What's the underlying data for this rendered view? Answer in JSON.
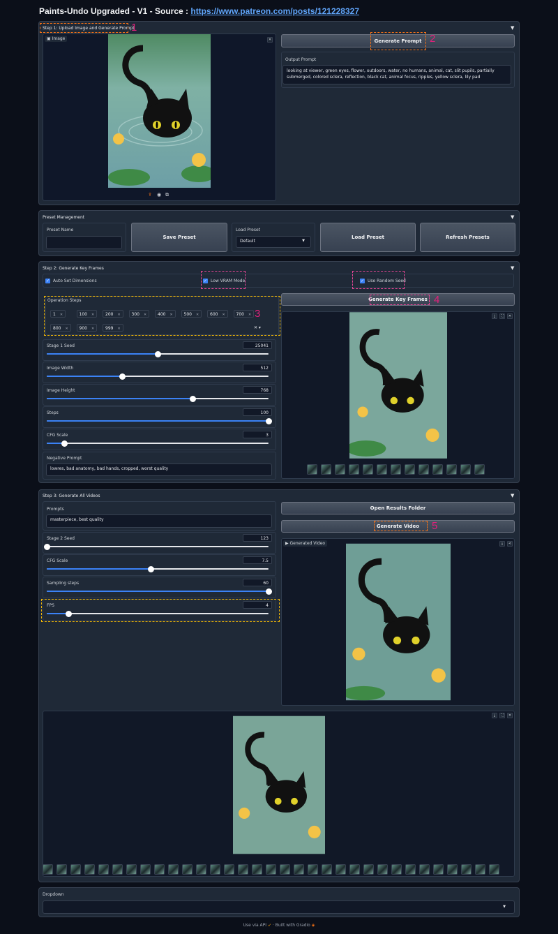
{
  "title": "Paints-Undo Upgraded - V1 - Source : ",
  "title_link": "https://www.patreon.com/posts/121228327",
  "step1": {
    "title": "Step 1: Upload Image and Generate Prompt",
    "image_label": "Image",
    "generate_btn": "Generate Prompt",
    "output_label": "Output Prompt",
    "output_value": "looking at viewer, green eyes, flower, outdoors, water, no humans, animal, cat, slit pupils, partially submerged, colored sclera, reflection, black cat, animal focus, ripples, yellow sclera, lily pad"
  },
  "preset": {
    "title": "Preset Management",
    "name_label": "Preset Name",
    "save_btn": "Save Preset",
    "load_label": "Load Preset",
    "load_value": "Default",
    "load_btn": "Load Preset",
    "refresh_btn": "Refresh Presets"
  },
  "step2": {
    "title": "Step 2: Generate Key Frames",
    "auto_dims": "Auto Set Dimensions",
    "low_vram": "Low VRAM Mode",
    "random_seed": "Use Random Seed",
    "op_steps_label": "Operation Steps",
    "op_steps": [
      "1",
      "100",
      "200",
      "300",
      "400",
      "500",
      "600",
      "700",
      "800",
      "900",
      "999"
    ],
    "gen_btn": "Generate Key Frames",
    "sliders": [
      {
        "label": "Stage 1 Seed",
        "value": "25041",
        "frac": 0.5
      },
      {
        "label": "Image Width",
        "value": "512",
        "frac": 0.34
      },
      {
        "label": "Image Height",
        "value": "768",
        "frac": 0.66
      },
      {
        "label": "Steps",
        "value": "100",
        "frac": 1.0
      },
      {
        "label": "CFG Scale",
        "value": "3",
        "frac": 0.08
      }
    ],
    "neg_label": "Negative Prompt",
    "neg_value": "lowres, bad anatomy, bad hands, cropped, worst quality"
  },
  "step3": {
    "title": "Step 3: Generate All Videos",
    "prompts_label": "Prompts",
    "prompts_value": "masterpiece, best quality",
    "open_btn": "Open Results Folder",
    "gen_btn": "Generate Video",
    "video_label": "Generated Video",
    "sliders": [
      {
        "label": "Stage 2 Seed",
        "value": "123",
        "frac": 0.0
      },
      {
        "label": "CFG Scale",
        "value": "7.5",
        "frac": 0.47
      },
      {
        "label": "Sampling steps",
        "value": "60",
        "frac": 1.0
      },
      {
        "label": "FPS",
        "value": "4",
        "frac": 0.1
      }
    ]
  },
  "dropdown": {
    "label": "Dropdown"
  },
  "footer": {
    "api": "Use via API",
    "sep": "·",
    "built": "Built with Gradio"
  },
  "annotations": [
    "1",
    "2",
    "3",
    "4",
    "5"
  ],
  "colors": {
    "accent": "#3b82f6",
    "annotation": "#e0217b",
    "dash_orange": "#f97316",
    "dash_yellow": "#eab308",
    "dash_pink": "#ec4899"
  }
}
